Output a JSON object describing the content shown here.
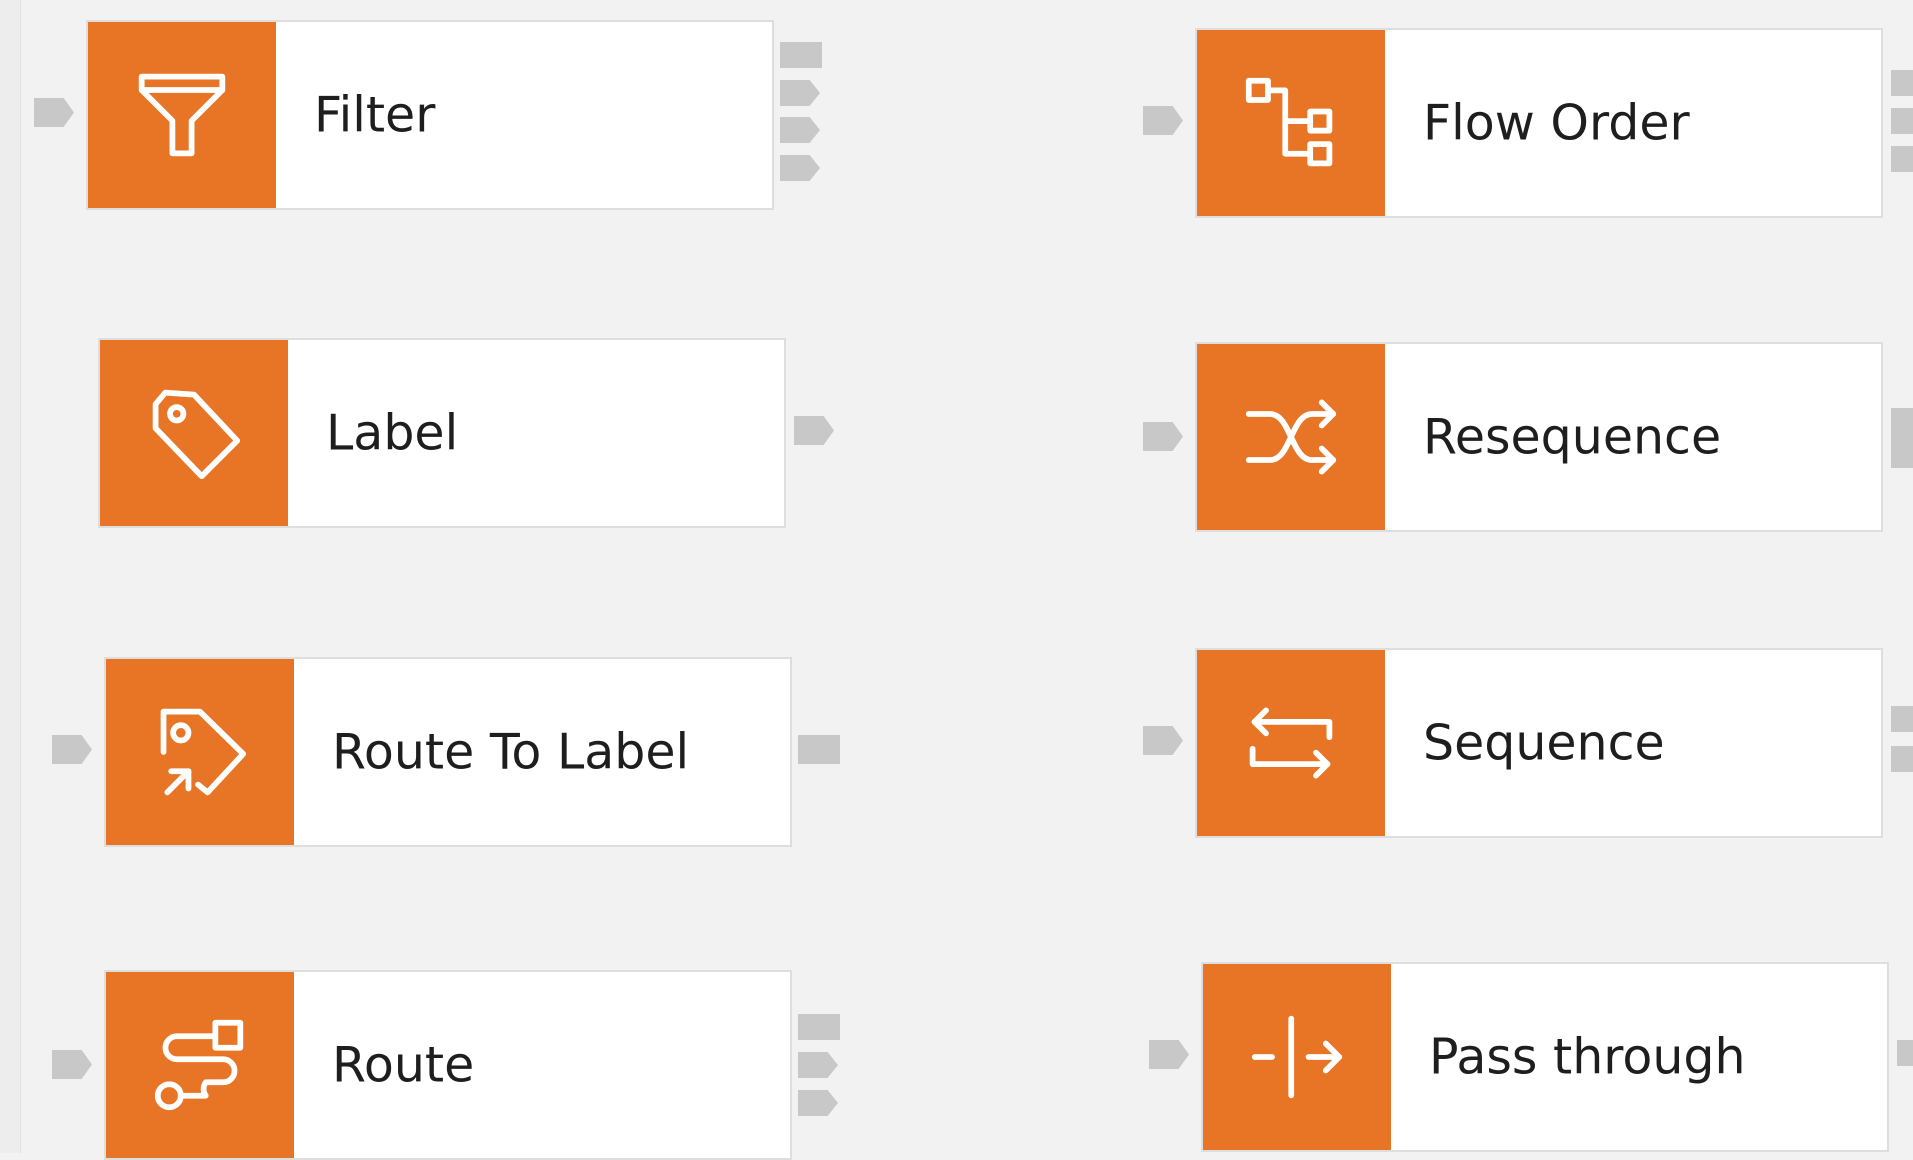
{
  "canvas": {
    "nodes": [
      {
        "id": "filter",
        "label": "Filter",
        "icon": "filter-icon"
      },
      {
        "id": "label",
        "label": "Label",
        "icon": "tag-icon"
      },
      {
        "id": "route-to-label",
        "label": "Route To Label",
        "icon": "tag-route-icon"
      },
      {
        "id": "route",
        "label": "Route",
        "icon": "route-icon"
      },
      {
        "id": "flow-order",
        "label": "Flow Order",
        "icon": "hierarchy-icon"
      },
      {
        "id": "resequence",
        "label": "Resequence",
        "icon": "shuffle-icon"
      },
      {
        "id": "sequence",
        "label": "Sequence",
        "icon": "loop-arrows-icon"
      },
      {
        "id": "pass-through",
        "label": "Pass through",
        "icon": "pass-through-icon"
      }
    ]
  },
  "colors": {
    "accent": "#e87426",
    "background": "#f2f2f2",
    "port": "#c8c8c8",
    "node_border": "#dedede"
  }
}
